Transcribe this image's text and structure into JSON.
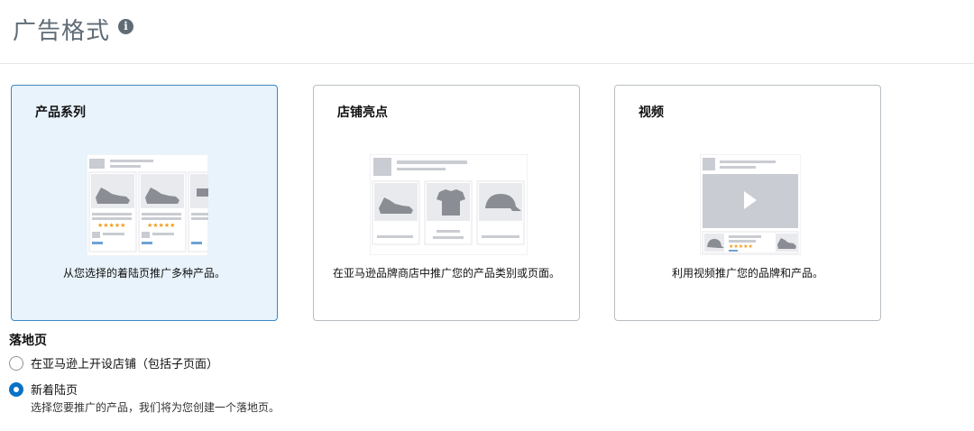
{
  "header": {
    "title": "广告格式",
    "info_icon": "info-icon"
  },
  "ad_formats": [
    {
      "title": "产品系列",
      "description": "从您选择的着陆页推广多种产品。",
      "selected": true
    },
    {
      "title": "店铺亮点",
      "description": "在亚马逊品牌商店中推广您的产品类别或页面。",
      "selected": false
    },
    {
      "title": "视频",
      "description": "利用视频推广您的品牌和产品。",
      "selected": false
    }
  ],
  "landing_page": {
    "label": "落地页",
    "options": [
      {
        "label": "在亚马逊上开设店铺（包括子页面）",
        "checked": false
      },
      {
        "label": "新着陆页",
        "checked": true,
        "helper": "选择您要推广的产品，我们将为您创建一个落地页。"
      }
    ]
  },
  "colors": {
    "accent": "#0972c4",
    "selected_bg": "#e8f3fc",
    "selected_border": "#3a87c6",
    "placeholder_gray": "#c9ccd2",
    "star": "#f29b18"
  }
}
